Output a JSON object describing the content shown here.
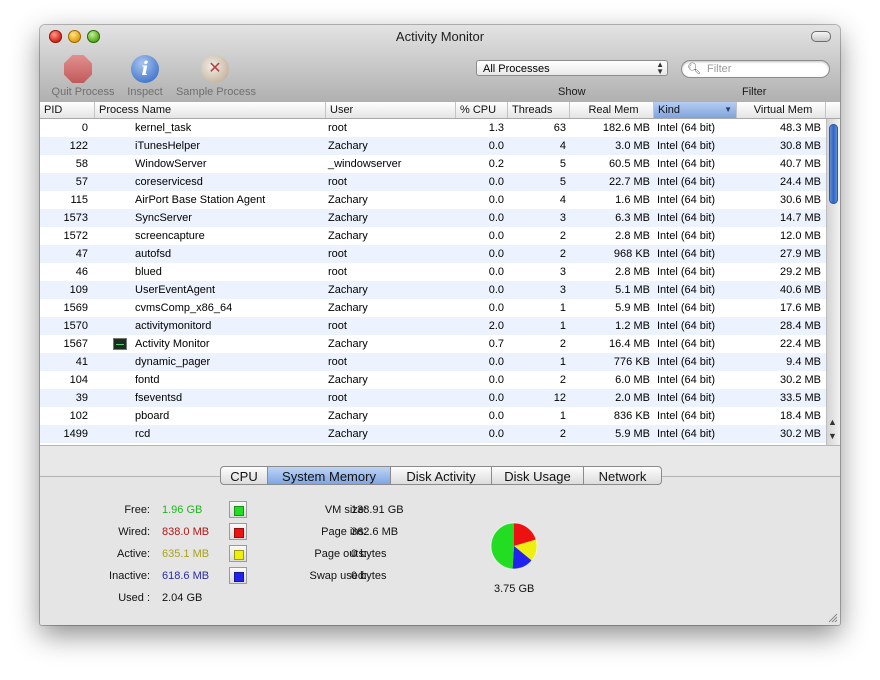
{
  "window": {
    "title": "Activity Monitor"
  },
  "toolbar": {
    "quit_label": "Quit Process",
    "inspect_label": "Inspect",
    "sample_label": "Sample Process",
    "show_select_value": "All Processes",
    "show_label": "Show",
    "filter_placeholder": "Filter",
    "filter_label": "Filter"
  },
  "table": {
    "columns": [
      "PID",
      "Process Name",
      "User",
      "% CPU",
      "Threads",
      "Real Mem",
      "Kind",
      "Virtual Mem"
    ],
    "sorted_column": "Kind",
    "rows": [
      {
        "pid": "0",
        "name": "kernel_task",
        "user": "root",
        "cpu": "1.3",
        "threads": "63",
        "real": "182.6 MB",
        "kind": "Intel (64 bit)",
        "virt": "48.3 MB"
      },
      {
        "pid": "122",
        "name": "iTunesHelper",
        "user": "Zachary",
        "cpu": "0.0",
        "threads": "4",
        "real": "3.0 MB",
        "kind": "Intel (64 bit)",
        "virt": "30.8 MB"
      },
      {
        "pid": "58",
        "name": "WindowServer",
        "user": "_windowserver",
        "cpu": "0.2",
        "threads": "5",
        "real": "60.5 MB",
        "kind": "Intel (64 bit)",
        "virt": "40.7 MB"
      },
      {
        "pid": "57",
        "name": "coreservicesd",
        "user": "root",
        "cpu": "0.0",
        "threads": "5",
        "real": "22.7 MB",
        "kind": "Intel (64 bit)",
        "virt": "24.4 MB"
      },
      {
        "pid": "115",
        "name": "AirPort Base Station Agent",
        "user": "Zachary",
        "cpu": "0.0",
        "threads": "4",
        "real": "1.6 MB",
        "kind": "Intel (64 bit)",
        "virt": "30.6 MB"
      },
      {
        "pid": "1573",
        "name": "SyncServer",
        "user": "Zachary",
        "cpu": "0.0",
        "threads": "3",
        "real": "6.3 MB",
        "kind": "Intel (64 bit)",
        "virt": "14.7 MB"
      },
      {
        "pid": "1572",
        "name": "screencapture",
        "user": "Zachary",
        "cpu": "0.0",
        "threads": "2",
        "real": "2.8 MB",
        "kind": "Intel (64 bit)",
        "virt": "12.0 MB"
      },
      {
        "pid": "47",
        "name": "autofsd",
        "user": "root",
        "cpu": "0.0",
        "threads": "2",
        "real": "968 KB",
        "kind": "Intel (64 bit)",
        "virt": "27.9 MB"
      },
      {
        "pid": "46",
        "name": "blued",
        "user": "root",
        "cpu": "0.0",
        "threads": "3",
        "real": "2.8 MB",
        "kind": "Intel (64 bit)",
        "virt": "29.2 MB"
      },
      {
        "pid": "109",
        "name": "UserEventAgent",
        "user": "Zachary",
        "cpu": "0.0",
        "threads": "3",
        "real": "5.1 MB",
        "kind": "Intel (64 bit)",
        "virt": "40.6 MB"
      },
      {
        "pid": "1569",
        "name": "cvmsComp_x86_64",
        "user": "Zachary",
        "cpu": "0.0",
        "threads": "1",
        "real": "5.9 MB",
        "kind": "Intel (64 bit)",
        "virt": "17.6 MB"
      },
      {
        "pid": "1570",
        "name": "activitymonitord",
        "user": "root",
        "cpu": "2.0",
        "threads": "1",
        "real": "1.2 MB",
        "kind": "Intel (64 bit)",
        "virt": "28.4 MB"
      },
      {
        "pid": "1567",
        "name": "Activity Monitor",
        "user": "Zachary",
        "cpu": "0.7",
        "threads": "2",
        "real": "16.4 MB",
        "kind": "Intel (64 bit)",
        "virt": "22.4 MB",
        "icon": "activity-monitor-app-icon"
      },
      {
        "pid": "41",
        "name": "dynamic_pager",
        "user": "root",
        "cpu": "0.0",
        "threads": "1",
        "real": "776 KB",
        "kind": "Intel (64 bit)",
        "virt": "9.4 MB"
      },
      {
        "pid": "104",
        "name": "fontd",
        "user": "Zachary",
        "cpu": "0.0",
        "threads": "2",
        "real": "6.0 MB",
        "kind": "Intel (64 bit)",
        "virt": "30.2 MB"
      },
      {
        "pid": "39",
        "name": "fseventsd",
        "user": "root",
        "cpu": "0.0",
        "threads": "12",
        "real": "2.0 MB",
        "kind": "Intel (64 bit)",
        "virt": "33.5 MB"
      },
      {
        "pid": "102",
        "name": "pboard",
        "user": "Zachary",
        "cpu": "0.0",
        "threads": "1",
        "real": "836 KB",
        "kind": "Intel (64 bit)",
        "virt": "18.4 MB"
      },
      {
        "pid": "1499",
        "name": "rcd",
        "user": "Zachary",
        "cpu": "0.0",
        "threads": "2",
        "real": "5.9 MB",
        "kind": "Intel (64 bit)",
        "virt": "30.2 MB"
      }
    ]
  },
  "tabs": [
    "CPU",
    "System Memory",
    "Disk Activity",
    "Disk Usage",
    "Network"
  ],
  "active_tab": "System Memory",
  "memory": {
    "free_label": "Free:",
    "free_value": "1.96 GB",
    "free_color": "#1fb81f",
    "wired_label": "Wired:",
    "wired_value": "838.0 MB",
    "wired_color": "#b01818",
    "active_label": "Active:",
    "active_value": "635.1 MB",
    "active_color": "#a9a21a",
    "inactive_label": "Inactive:",
    "inactive_value": "618.6 MB",
    "inactive_color": "#2b2ba8",
    "used_label": "Used :",
    "used_value": "2.04 GB",
    "vm_size_label": "VM size:",
    "vm_size_value": "138.91 GB",
    "page_ins_label": "Page ins:",
    "page_ins_value": "362.6 MB",
    "page_outs_label": "Page outs:",
    "page_outs_value": "0 bytes",
    "swap_used_label": "Swap used:",
    "swap_used_value": "0 bytes",
    "total": "3.75 GB"
  },
  "colors": {
    "free_swatch": "#22dd22",
    "wired_swatch": "#ee1111",
    "active_swatch": "#eeee11",
    "inactive_swatch": "#2222ee"
  }
}
